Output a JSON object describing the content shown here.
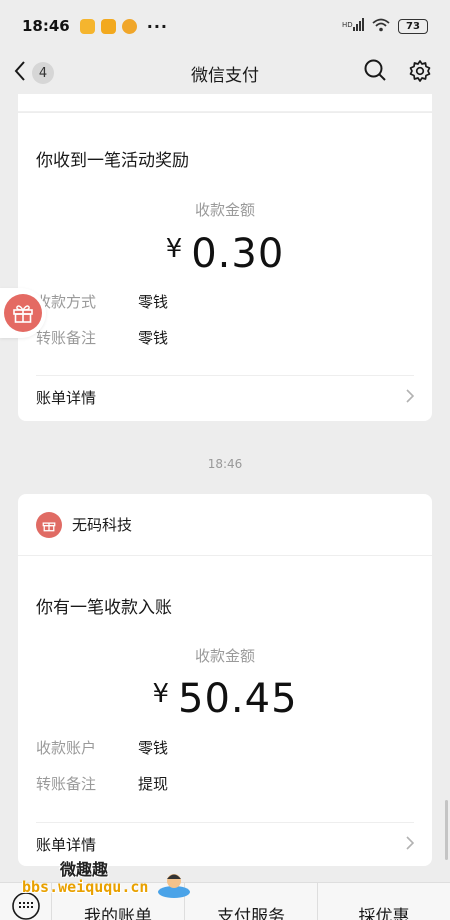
{
  "status_bar": {
    "time": "18:46",
    "more": "···",
    "battery": "73",
    "signal": "HD"
  },
  "nav": {
    "badge_count": "4",
    "title": "微信支付"
  },
  "card1": {
    "heading": "你收到一笔活动奖励",
    "amount_label": "收款金额",
    "currency": "¥",
    "amount": "0.30",
    "rows": [
      {
        "key": "收款方式",
        "value": "零钱"
      },
      {
        "key": "转账备注",
        "value": "零钱"
      }
    ],
    "detail": "账单详情"
  },
  "timestamp": "18:46",
  "card2": {
    "merchant": "无码科技",
    "heading": "你有一笔收款入账",
    "amount_label": "收款金额",
    "currency": "¥",
    "amount": "50.45",
    "rows": [
      {
        "key": "收款账户",
        "value": "零钱"
      },
      {
        "key": "转账备注",
        "value": "提现"
      }
    ],
    "detail": "账单详情"
  },
  "bottom_menu": {
    "items": [
      "我的账单",
      "支付服务",
      "採优惠"
    ]
  },
  "watermark": {
    "top": "微趣趣",
    "bottom": "bbs.weiququ.cn"
  },
  "icons": {
    "back": "chevron-left-icon",
    "search": "search-icon",
    "settings": "gear-icon",
    "gift": "gift-icon",
    "keyboard": "keyboard-icon"
  },
  "colors": {
    "accent_red": "#e46a63",
    "background": "#ededed"
  }
}
